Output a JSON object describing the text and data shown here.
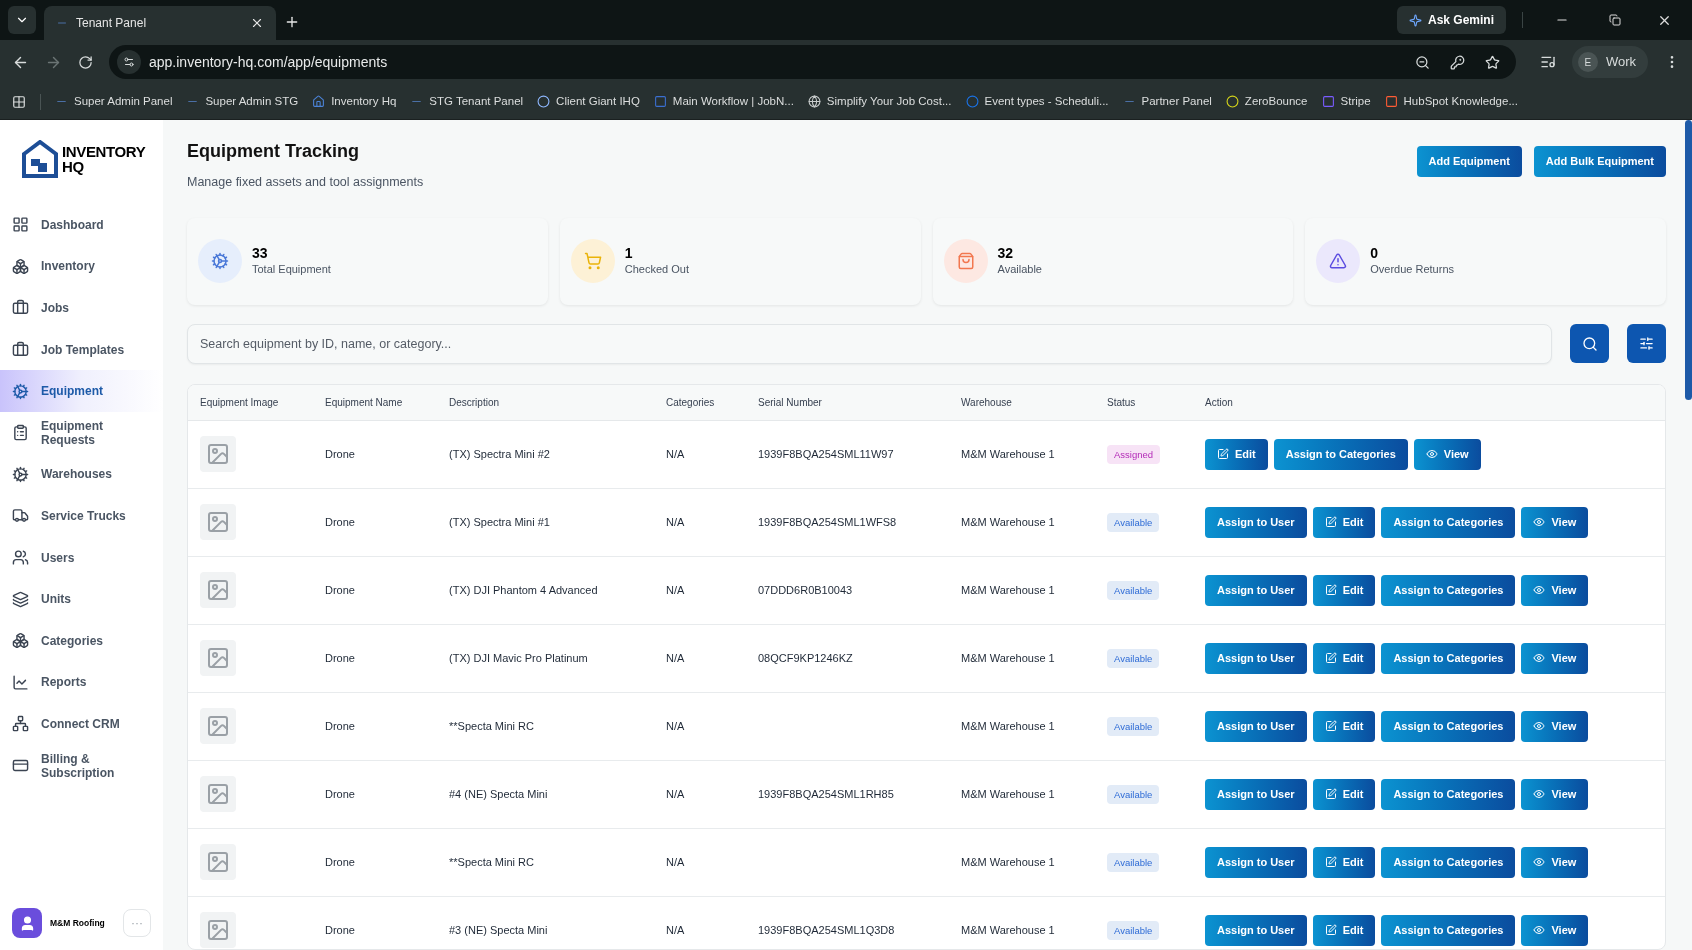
{
  "browser": {
    "tab_title": "Tenant Panel",
    "url": "app.inventory-hq.com/app/equipments",
    "ask_button": "Ask Gemini",
    "profile_initial": "E",
    "profile_name": "Work",
    "bookmarks": [
      "Super Admin Panel",
      "Super Admin STG",
      "Inventory Hq",
      "STG Tenant Panel",
      "Client Giant IHQ",
      "Main Workflow | JobN...",
      "Simplify Your Job Cost...",
      "Event types - Scheduli...",
      "Partner Panel",
      "ZeroBounce",
      "Stripe",
      "HubSpot Knowledge..."
    ]
  },
  "sidebar": {
    "logo_line1": "INVENTORY",
    "logo_line2": "HQ",
    "items": [
      {
        "label": "Dashboard",
        "selected": false
      },
      {
        "label": "Inventory",
        "selected": false
      },
      {
        "label": "Jobs",
        "selected": false
      },
      {
        "label": "Job Templates",
        "selected": false
      },
      {
        "label": "Equipment",
        "selected": true
      },
      {
        "label": "Equipment Requests",
        "selected": false
      },
      {
        "label": "Warehouses",
        "selected": false
      },
      {
        "label": "Service Trucks",
        "selected": false
      },
      {
        "label": "Users",
        "selected": false
      },
      {
        "label": "Units",
        "selected": false
      },
      {
        "label": "Categories",
        "selected": false
      },
      {
        "label": "Reports",
        "selected": false
      },
      {
        "label": "Connect CRM",
        "selected": false
      },
      {
        "label": "Billing & Subscription",
        "selected": false
      }
    ],
    "account": {
      "name": "M&M Roofing",
      "menu": "···"
    }
  },
  "page": {
    "title": "Equipment Tracking",
    "subtitle": "Manage fixed assets and tool assignments",
    "buttons": [
      "Add Equipment",
      "Add Bulk Equipment"
    ]
  },
  "stats": [
    {
      "value": "33",
      "label": "Total Equipment"
    },
    {
      "value": "1",
      "label": "Checked Out"
    },
    {
      "value": "32",
      "label": "Available"
    },
    {
      "value": "0",
      "label": "Overdue Returns"
    }
  ],
  "search": {
    "placeholder": "Search equipment by ID, name, or category..."
  },
  "table": {
    "columns": [
      "Equipment Image",
      "Equipment Name",
      "Description",
      "Categories",
      "Serial Number",
      "Warehouse",
      "Status",
      "Action"
    ],
    "rows": [
      {
        "name": "Drone",
        "description": "(TX) Spectra Mini #2",
        "category": "N/A",
        "serial": "1939F8BQA254SML11W97",
        "warehouse": "M&M Warehouse 1",
        "status": {
          "kind": "assigned",
          "label": "Assigned"
        },
        "actions": [
          {
            "kind": "edit",
            "label": "Edit"
          },
          {
            "kind": "categories",
            "label": "Assign to Categories"
          },
          {
            "kind": "view",
            "label": "View"
          }
        ]
      },
      {
        "name": "Drone",
        "description": "(TX) Spectra Mini #1",
        "category": "N/A",
        "serial": "1939F8BQA254SML1WFS8",
        "warehouse": "M&M Warehouse 1",
        "status": {
          "kind": "available",
          "label": "Available"
        },
        "actions": [
          {
            "kind": "assign",
            "label": "Assign to User"
          },
          {
            "kind": "edit",
            "label": "Edit"
          },
          {
            "kind": "categories",
            "label": "Assign to Categories"
          },
          {
            "kind": "view",
            "label": "View"
          }
        ]
      },
      {
        "name": "Drone",
        "description": "(TX) DJI Phantom 4 Advanced",
        "category": "N/A",
        "serial": "07DDD6R0B10043",
        "warehouse": "M&M Warehouse 1",
        "status": {
          "kind": "available",
          "label": "Available"
        },
        "actions": [
          {
            "kind": "assign",
            "label": "Assign to User"
          },
          {
            "kind": "edit",
            "label": "Edit"
          },
          {
            "kind": "categories",
            "label": "Assign to Categories"
          },
          {
            "kind": "view",
            "label": "View"
          }
        ]
      },
      {
        "name": "Drone",
        "description": "(TX) DJI Mavic Pro Platinum",
        "category": "N/A",
        "serial": "08QCF9KP1246KZ",
        "warehouse": "M&M Warehouse 1",
        "status": {
          "kind": "available",
          "label": "Available"
        },
        "actions": [
          {
            "kind": "assign",
            "label": "Assign to User"
          },
          {
            "kind": "edit",
            "label": "Edit"
          },
          {
            "kind": "categories",
            "label": "Assign to Categories"
          },
          {
            "kind": "view",
            "label": "View"
          }
        ]
      },
      {
        "name": "Drone",
        "description": "**Specta Mini RC",
        "category": "N/A",
        "warehouse": "M&M Warehouse 1",
        "status": {
          "kind": "available",
          "label": "Available"
        },
        "actions": [
          {
            "kind": "assign",
            "label": "Assign to User"
          },
          {
            "kind": "edit",
            "label": "Edit"
          },
          {
            "kind": "categories",
            "label": "Assign to Categories"
          },
          {
            "kind": "view",
            "label": "View"
          }
        ]
      },
      {
        "name": "Drone",
        "description": "#4 (NE) Specta Mini",
        "category": "N/A",
        "serial": "1939F8BQA254SML1RH85",
        "warehouse": "M&M Warehouse 1",
        "status": {
          "kind": "available",
          "label": "Available"
        },
        "actions": [
          {
            "kind": "assign",
            "label": "Assign to User"
          },
          {
            "kind": "edit",
            "label": "Edit"
          },
          {
            "kind": "categories",
            "label": "Assign to Categories"
          },
          {
            "kind": "view",
            "label": "View"
          }
        ]
      },
      {
        "name": "Drone",
        "description": "**Specta Mini RC",
        "category": "N/A",
        "warehouse": "M&M Warehouse 1",
        "status": {
          "kind": "available",
          "label": "Available"
        },
        "actions": [
          {
            "kind": "assign",
            "label": "Assign to User"
          },
          {
            "kind": "edit",
            "label": "Edit"
          },
          {
            "kind": "categories",
            "label": "Assign to Categories"
          },
          {
            "kind": "view",
            "label": "View"
          }
        ]
      },
      {
        "name": "Drone",
        "description": "#3 (NE) Specta Mini",
        "category": "N/A",
        "serial": "1939F8BQA254SML1Q3D8",
        "warehouse": "M&M Warehouse 1",
        "status": {
          "kind": "available",
          "label": "Available"
        },
        "actions": [
          {
            "kind": "assign",
            "label": "Assign to User"
          },
          {
            "kind": "edit",
            "label": "Edit"
          },
          {
            "kind": "categories",
            "label": "Assign to Categories"
          },
          {
            "kind": "view",
            "label": "View"
          }
        ]
      }
    ]
  }
}
